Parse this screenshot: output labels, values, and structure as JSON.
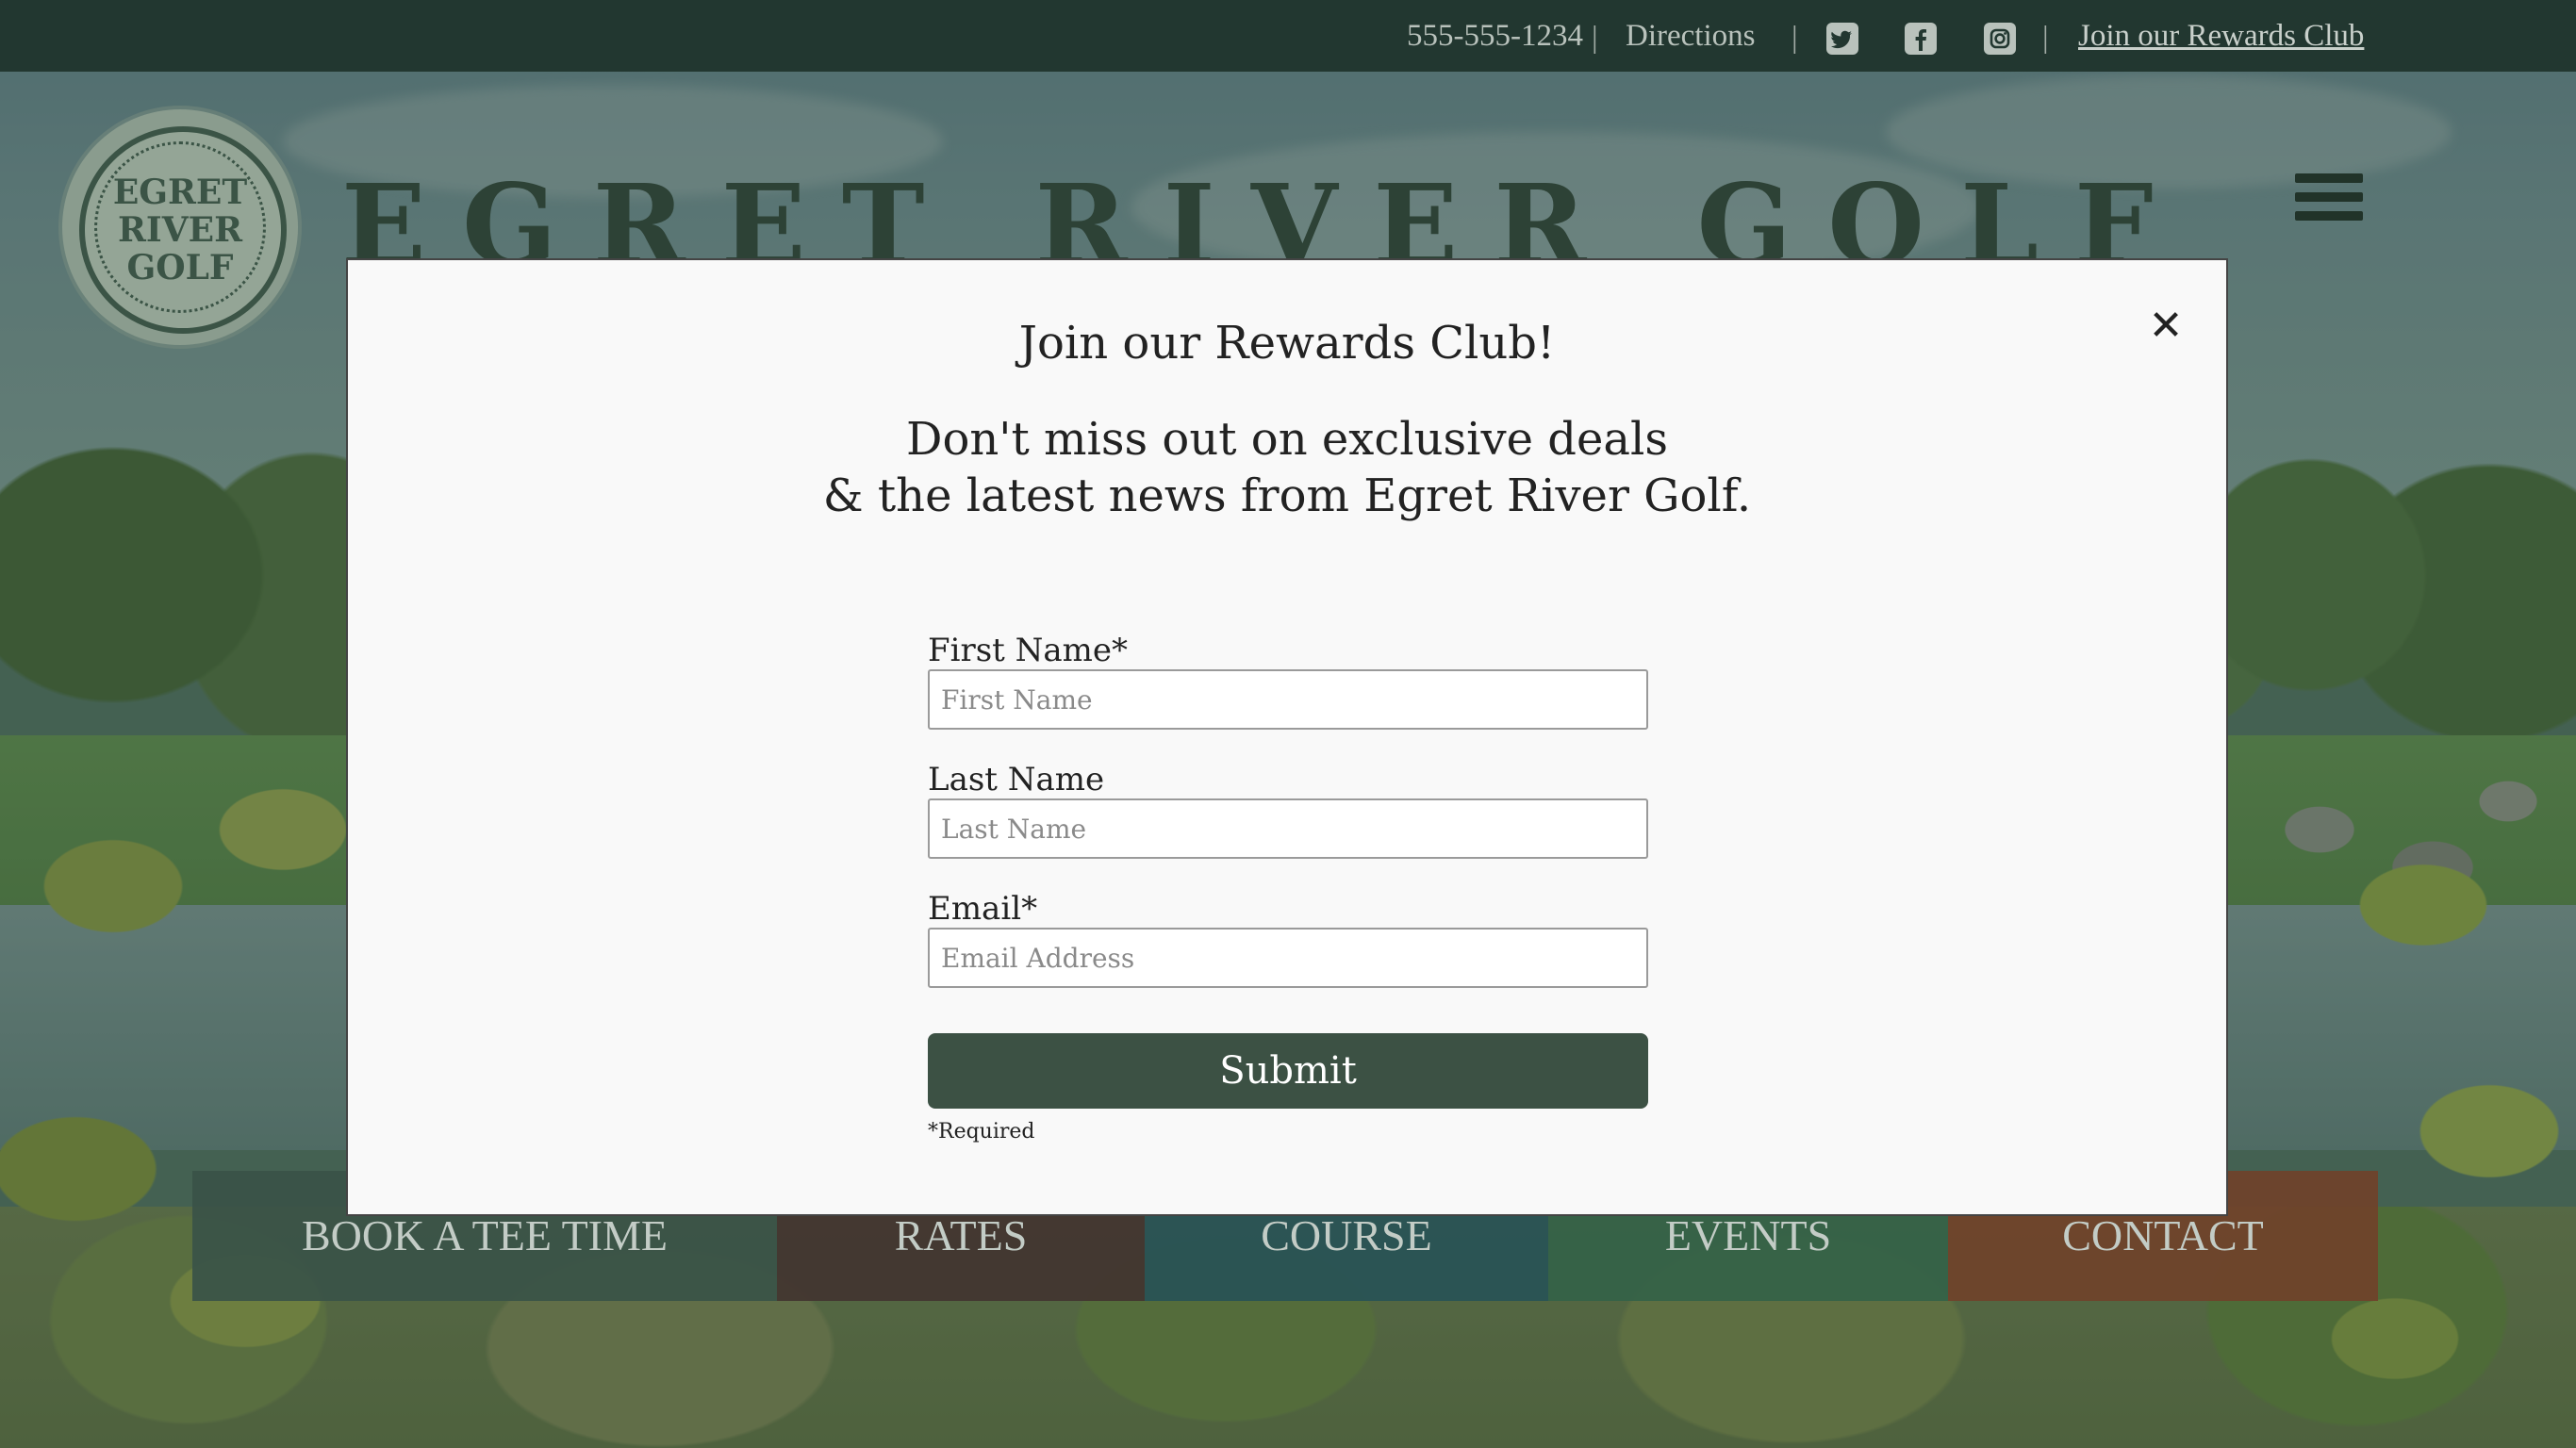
{
  "topbar": {
    "phone": "555-555-1234",
    "separator": "|",
    "directions": "Directions",
    "social": [
      "twitter-icon",
      "facebook-icon",
      "instagram-icon"
    ],
    "rewards_link": "Join our Rewards Club"
  },
  "header": {
    "logo_lines": [
      "EGRET",
      "RIVER",
      "GOLF"
    ],
    "brand": "EGRET RIVER GOLF",
    "menu_icon": "hamburger-menu-icon"
  },
  "nav": {
    "tiles": [
      "BOOK A TEE TIME",
      "RATES",
      "COURSE",
      "EVENTS",
      "CONTACT"
    ]
  },
  "modal": {
    "title": "Join our Rewards Club!",
    "subtitle_line1": "Don't miss out on exclusive deals",
    "subtitle_line2": "& the latest news from Egret River Golf.",
    "close_glyph": "✕",
    "fields": {
      "first_name": {
        "label": "First Name*",
        "placeholder": "First Name",
        "value": ""
      },
      "last_name": {
        "label": "Last Name",
        "placeholder": "Last Name",
        "value": ""
      },
      "email": {
        "label": "Email*",
        "placeholder": "Email Address",
        "value": ""
      }
    },
    "submit_label": "Submit",
    "required_note": "*Required"
  },
  "colors": {
    "topbar_bg": "#223730",
    "brand_text": "#2d4236",
    "submit_bg": "#3c5144",
    "tile_book": "#3a5248",
    "tile_rates": "#423430",
    "tile_course": "#285256",
    "tile_events": "#346248",
    "tile_contact": "#70422a"
  }
}
